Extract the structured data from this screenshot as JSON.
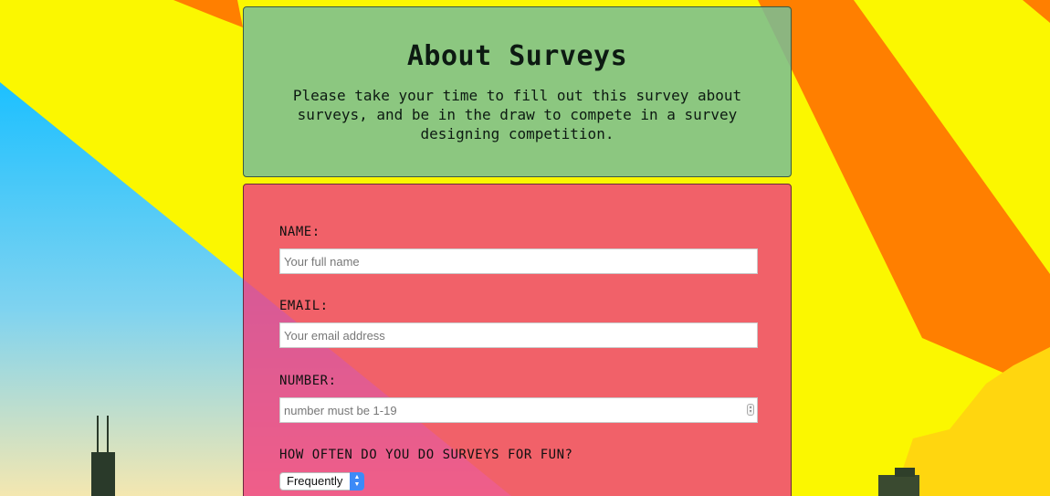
{
  "header": {
    "title": "About Surveys",
    "description": "Please take your time to fill out this survey about surveys, and be in the draw to compete in a survey designing competition."
  },
  "form": {
    "name": {
      "label": "NAME:",
      "placeholder": "Your full name",
      "value": ""
    },
    "email": {
      "label": "EMAIL:",
      "placeholder": "Your email address",
      "value": ""
    },
    "number": {
      "label": "NUMBER:",
      "placeholder": "number must be 1-19",
      "value": ""
    },
    "frequency": {
      "label": "HOW OFTEN DO YOU DO SURVEYS FOR FUN?",
      "selected": "Frequently"
    }
  },
  "icons": {
    "spinner": "number-stepper-icon",
    "select_arrow": "chevron-updown-icon"
  },
  "colors": {
    "background_yellow": "#fbf700",
    "background_orange": "#ff7f00",
    "background_sky": "#1ec2ff",
    "header_card": "#78be96",
    "form_card": "#ee4080",
    "select_accent": "#3d8af7"
  }
}
